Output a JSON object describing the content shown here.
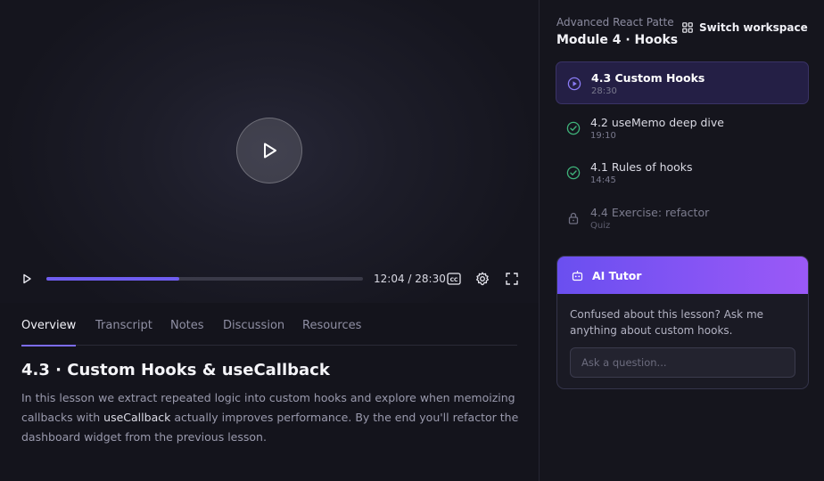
{
  "player": {
    "time_current": "12:04",
    "time_total": "28:30",
    "progress": 0.42
  },
  "tabs": [
    {
      "label": "Overview",
      "active": true
    },
    {
      "label": "Transcript",
      "active": false
    },
    {
      "label": "Notes",
      "active": false
    },
    {
      "label": "Discussion",
      "active": false
    },
    {
      "label": "Resources",
      "active": false
    }
  ],
  "lesson": {
    "title": "4.3 · Custom Hooks & useCallback",
    "desc_part1": "In this lesson we extract repeated logic into custom hooks and explore when memoizing callbacks with ",
    "desc_highlight": "useCallback",
    "desc_part2": " actually improves performance. By the end you'll refactor the dashboard widget from the previous lesson."
  },
  "sidebar": {
    "course_name": "Advanced React Patterns",
    "module_title": "Module 4 · Hooks",
    "switch_label": "Switch workspace",
    "lessons": [
      {
        "name": "4.3 Custom Hooks",
        "meta": "28:30",
        "state": "playing"
      },
      {
        "name": "4.2 useMemo deep dive",
        "meta": "19:10",
        "state": "done"
      },
      {
        "name": "4.1 Rules of hooks",
        "meta": "14:45",
        "state": "done"
      },
      {
        "name": "4.4 Exercise: refactor",
        "meta": "Quiz",
        "state": "locked"
      }
    ]
  },
  "tutor": {
    "title": "AI Tutor",
    "text": "Confused about this lesson? Ask me anything about custom hooks.",
    "placeholder": "Ask a question..."
  },
  "colors": {
    "accent": "#7c6cf4",
    "progress": "#6f5df0",
    "done": "#3fb37a",
    "tutor_gradient_start": "#6a4ff0",
    "tutor_gradient_end": "#9b59f7"
  }
}
